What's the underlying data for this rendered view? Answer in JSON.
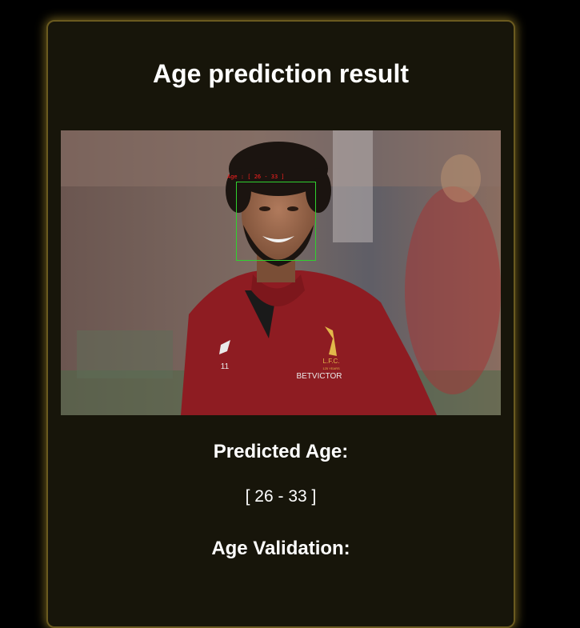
{
  "page": {
    "title": "Age prediction result"
  },
  "photo": {
    "subject": "smiling man in red Liverpool training top",
    "detection_label": "Age : [ 26 - 33 ]",
    "box_color": "#2fd12f",
    "label_color": "#ff2020",
    "shirt_texts": {
      "club": "L.F.C.",
      "years": "125 YEARS",
      "sponsor": "BETVICTOR"
    }
  },
  "result": {
    "predicted_heading": "Predicted Age:",
    "predicted_value": "[ 26 - 33 ]",
    "validation_heading": "Age Validation:"
  },
  "colors": {
    "background": "#000000",
    "card": "#17150a",
    "card_glow": "#bea032",
    "text": "#ffffff"
  }
}
